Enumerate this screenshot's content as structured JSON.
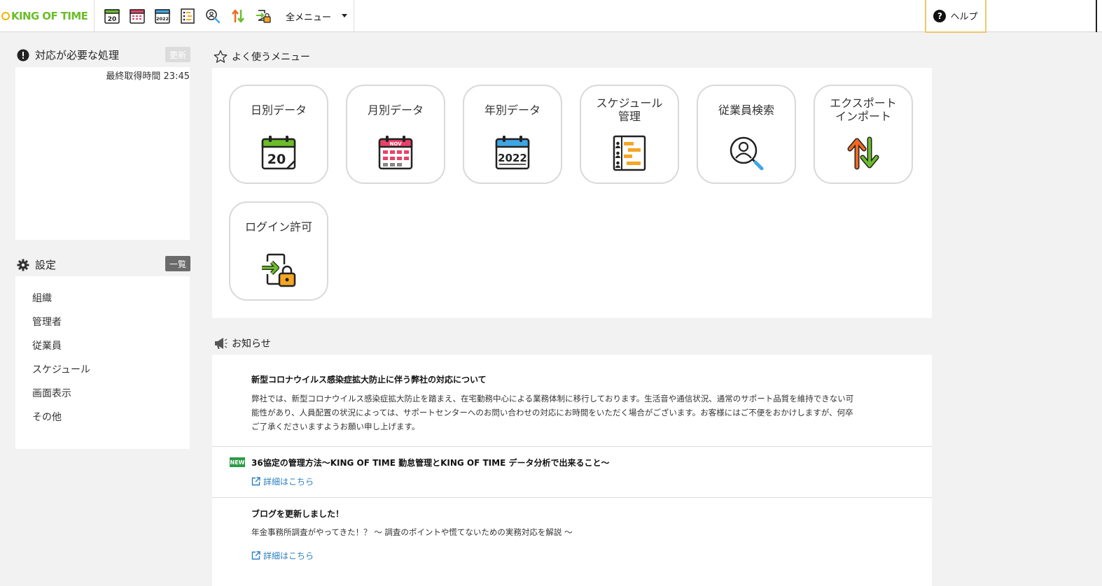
{
  "header": {
    "logo_text": "KING OF TIME",
    "toolbar_icons": [
      "daily-data-icon",
      "monthly-data-icon",
      "yearly-data-icon",
      "schedule-icon",
      "employee-search-icon",
      "export-import-icon",
      "login-permission-icon"
    ],
    "calendar_day": "20",
    "calendar_year": "2022",
    "menu_label": "全メニュー",
    "help_label": "ヘルプ"
  },
  "pending": {
    "title": "対応が必要な処理",
    "refresh_label": "更新",
    "fetch_time": "最終取得時間 23:45"
  },
  "settings": {
    "title": "設定",
    "list_button": "一覧",
    "items": [
      "組織",
      "管理者",
      "従業員",
      "スケジュール",
      "画面表示",
      "その他"
    ]
  },
  "favorites": {
    "title": "よく使うメニュー",
    "tiles": [
      {
        "label": "日別データ",
        "icon": "daily-calendar-icon"
      },
      {
        "label": "月別データ",
        "icon": "monthly-calendar-icon"
      },
      {
        "label": "年別データ",
        "icon": "yearly-calendar-icon"
      },
      {
        "label": "スケジュール\n管理",
        "icon": "schedule-management-icon"
      },
      {
        "label": "従業員検索",
        "icon": "employee-search-icon"
      },
      {
        "label": "エクスポート\nインポート",
        "icon": "export-import-icon"
      },
      {
        "label": "ログイン許可",
        "icon": "login-permission-icon"
      }
    ],
    "month_label": "NOV"
  },
  "notices": {
    "title": "お知らせ",
    "items": [
      {
        "title": "新型コロナウイルス感染症拡大防止に伴う弊社の対応について",
        "body": "弊社では、新型コロナウイルス感染症拡大防止を踏まえ、在宅勤務中心による業務体制に移行しております。生活音や通信状況、通常のサポート品質を維持できない可能性があり、人員配置の状況によっては、サポートセンターへのお問い合わせの対応にお時間をいただく場合がございます。お客様にはご不便をおかけしますが、何卒ご了承くださいますようお願い申し上げます。"
      },
      {
        "badge": "NEW",
        "title": "36協定の管理方法〜KING OF TIME 勤怠管理とKING OF TIME データ分析で出来ること〜",
        "link": "詳細はこちら"
      },
      {
        "title": "ブログを更新しました！",
        "body": "年金事務所調査がやってきた！？ 〜 調査のポイントや慌てないための実務対応を解説 〜",
        "link": "詳細はこちら"
      }
    ]
  },
  "colors": {
    "green": "#6cbd2a",
    "orange": "#f5a623",
    "link": "#2a7fc0",
    "badge_gray": "#8a8a8a",
    "settings_btn": "#6b6b6b"
  }
}
